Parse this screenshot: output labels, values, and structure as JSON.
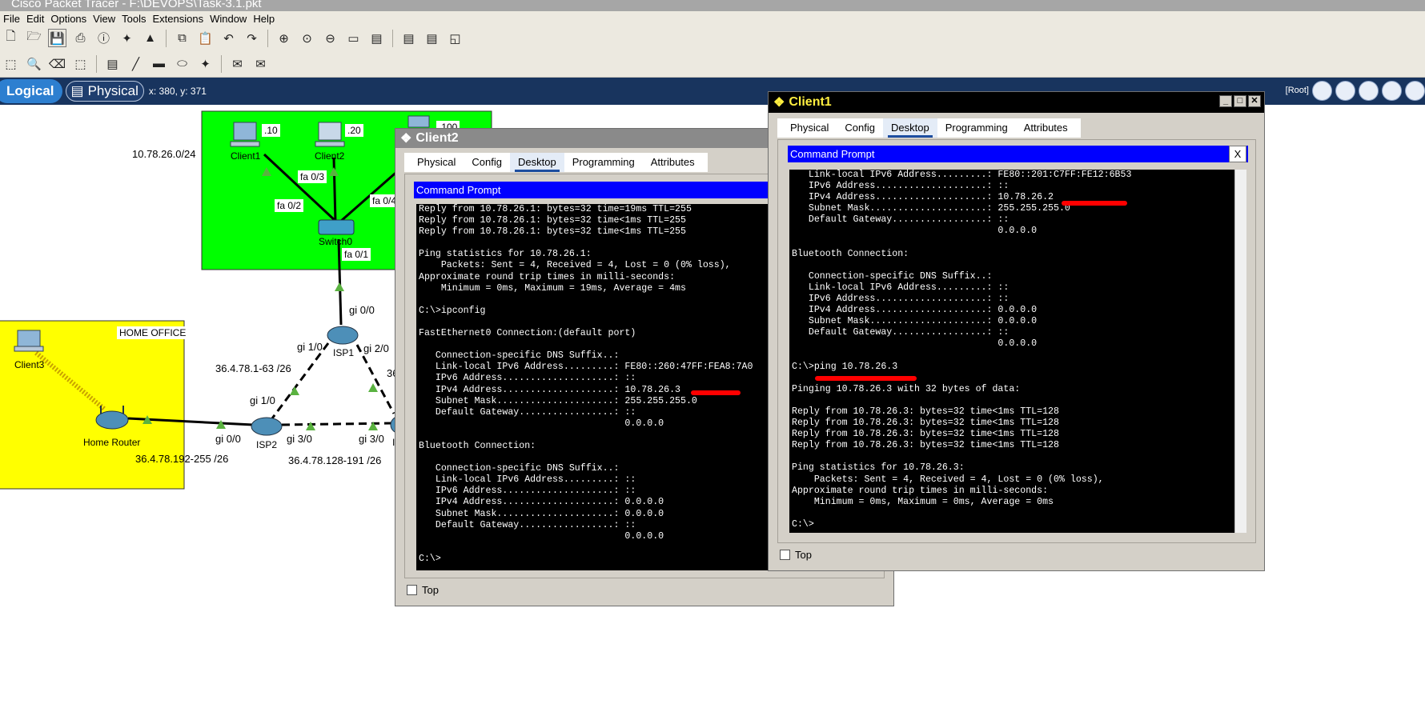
{
  "app": {
    "title": "Cisco Packet Tracer - F:\\DEVOPS\\Task-3.1.pkt",
    "menu": [
      "File",
      "Edit",
      "Options",
      "View",
      "Tools",
      "Extensions",
      "Window",
      "Help"
    ]
  },
  "toolbar1_icons": [
    "new-icon",
    "open-icon",
    "save-icon",
    "print-icon",
    "info-icon",
    "network-wizard-icon",
    "activity-wizard-icon",
    "copy-icon",
    "paste-icon",
    "undo-icon",
    "redo-icon",
    "zoom-in-icon",
    "zoom-reset-icon",
    "zoom-out-icon",
    "drawing-palette-icon",
    "custom-device-icon",
    "notes-icon",
    "simulation-icon",
    "viewport-icon"
  ],
  "toolbar2_icons": [
    "select-icon",
    "inspect-icon",
    "delete-icon",
    "resize-icon",
    "note-icon",
    "line-icon",
    "rectangle-icon",
    "ellipse-icon",
    "freeform-icon",
    "simple-pdu-icon",
    "complex-pdu-icon"
  ],
  "nav": {
    "logical": "Logical",
    "physical": "Physical",
    "coords": "x: 380, y: 371",
    "root": "[Root]"
  },
  "topology": {
    "subnet_lan": "10.78.26.0/24",
    "home_office": "HOME OFFICE",
    "net_isp1_isp2": "36.4.78.1-63 /26",
    "net_home": "36.4.78.192-255 /26",
    "net_isp2_isp3": "36.4.78.128-191 /26",
    "net_partial": "36",
    "client1": "Client1",
    "client1_ip": ".10",
    "client2": "Client2",
    "client2_ip": ".20",
    "server_ip": ".100",
    "switch": "Switch0",
    "client3": "Client3",
    "home_router": "Home Router",
    "isp1": "ISP1",
    "isp2": "ISP2",
    "isp3_partial": "I",
    "ports": {
      "fa03": "fa 0/3",
      "fa02": "fa 0/2",
      "fa04": "fa 0/4",
      "fa01": "fa 0/1",
      "isp1_gi00": "gi 0/0",
      "isp1_gi10": "gi 1/0",
      "isp1_gi20": "gi 2/0",
      "isp2_gi10": "gi 1/0",
      "isp2_gi00": "gi 0/0",
      "isp2_gi30": "gi 3/0",
      "isp3_gi30": "gi 3/0"
    },
    "colors": {
      "lan_area": "#00ff00",
      "home_area": "#ffff00",
      "link_up": "#5ab240"
    }
  },
  "client2": {
    "title": "Client2",
    "tabs": [
      "Physical",
      "Config",
      "Desktop",
      "Programming",
      "Attributes"
    ],
    "selected_tab": "Desktop",
    "cmd_header": "Command Prompt",
    "terminal": [
      "Reply from 10.78.26.1: bytes=32 time=19ms TTL=255",
      "Reply from 10.78.26.1: bytes=32 time<1ms TTL=255",
      "Reply from 10.78.26.1: bytes=32 time<1ms TTL=255",
      "",
      "Ping statistics for 10.78.26.1:",
      "    Packets: Sent = 4, Received = 4, Lost = 0 (0% loss),",
      "Approximate round trip times in milli-seconds:",
      "    Minimum = 0ms, Maximum = 19ms, Average = 4ms",
      "",
      "C:\\>ipconfig",
      "",
      "FastEthernet0 Connection:(default port)",
      "",
      "   Connection-specific DNS Suffix..:",
      "   Link-local IPv6 Address.........: FE80::260:47FF:FEA8:7A0",
      "   IPv6 Address....................: ::",
      "   IPv4 Address....................: 10.78.26.3",
      "   Subnet Mask.....................: 255.255.255.0",
      "   Default Gateway.................: ::",
      "                                     0.0.0.0",
      "",
      "Bluetooth Connection:",
      "",
      "   Connection-specific DNS Suffix..:",
      "   Link-local IPv6 Address.........: ::",
      "   IPv6 Address....................: ::",
      "   IPv4 Address....................: 0.0.0.0",
      "   Subnet Mask.....................: 0.0.0.0",
      "   Default Gateway.................: ::",
      "                                     0.0.0.0",
      "",
      "C:\\>"
    ],
    "top_label": "Top"
  },
  "client1": {
    "title": "Client1",
    "tabs": [
      "Physical",
      "Config",
      "Desktop",
      "Programming",
      "Attributes"
    ],
    "selected_tab": "Desktop",
    "cmd_header": "Command Prompt",
    "close_label": "X",
    "terminal": [
      "   Link-local IPv6 Address.........: FE80::201:C7FF:FE12:6B53",
      "   IPv6 Address....................: ::",
      "   IPv4 Address....................: 10.78.26.2",
      "   Subnet Mask.....................: 255.255.255.0",
      "   Default Gateway.................: ::",
      "                                     0.0.0.0",
      "",
      "Bluetooth Connection:",
      "",
      "   Connection-specific DNS Suffix..:",
      "   Link-local IPv6 Address.........: ::",
      "   IPv6 Address....................: ::",
      "   IPv4 Address....................: 0.0.0.0",
      "   Subnet Mask.....................: 0.0.0.0",
      "   Default Gateway.................: ::",
      "                                     0.0.0.0",
      "",
      "C:\\>ping 10.78.26.3",
      "",
      "Pinging 10.78.26.3 with 32 bytes of data:",
      "",
      "Reply from 10.78.26.3: bytes=32 time<1ms TTL=128",
      "Reply from 10.78.26.3: bytes=32 time<1ms TTL=128",
      "Reply from 10.78.26.3: bytes=32 time<1ms TTL=128",
      "Reply from 10.78.26.3: bytes=32 time<1ms TTL=128",
      "",
      "Ping statistics for 10.78.26.3:",
      "    Packets: Sent = 4, Received = 4, Lost = 0 (0% loss),",
      "Approximate round trip times in milli-seconds:",
      "    Minimum = 0ms, Maximum = 0ms, Average = 0ms",
      "",
      "C:\\>"
    ],
    "top_label": "Top"
  }
}
